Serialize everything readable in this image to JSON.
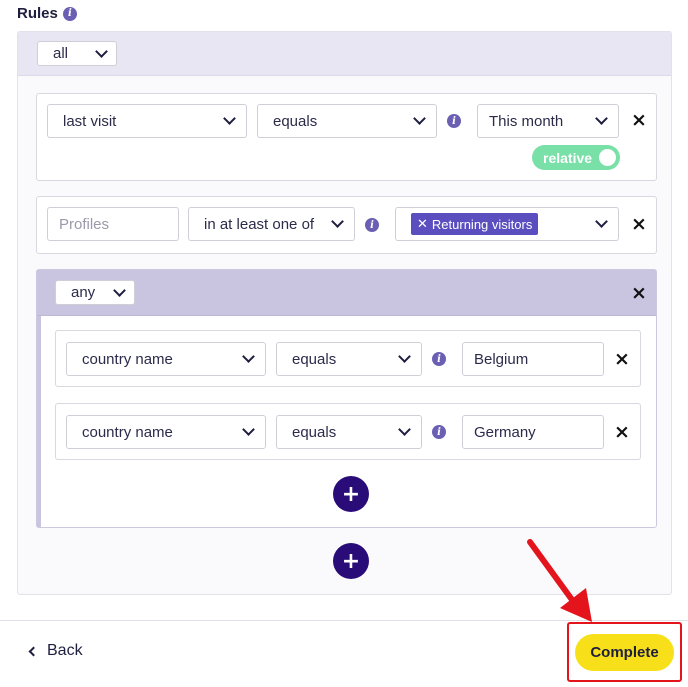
{
  "rules": {
    "title": "Rules",
    "info_icon": "info-icon"
  },
  "outer_group": {
    "match_select": "all",
    "rule1": {
      "field": "last visit",
      "operator": "equals",
      "value": "This month",
      "toggle_label": "relative"
    },
    "rule2": {
      "field_placeholder": "Profiles",
      "operator": "in at least one of",
      "tag": "Returning visitors"
    }
  },
  "inner_group": {
    "match_select": "any",
    "rule1": {
      "field": "country name",
      "operator": "equals",
      "value": "Belgium"
    },
    "rule2": {
      "field": "country name",
      "operator": "equals",
      "value": "Germany"
    }
  },
  "icons": {
    "remove": "×",
    "add": "+",
    "info": "i",
    "tag_remove": "✕"
  },
  "footer": {
    "back_label": "Back",
    "complete_label": "Complete"
  },
  "colors": {
    "accent": "#2a0c78",
    "toggle": "#79e0a8",
    "complete": "#f7e01a",
    "highlight": "#e3141c",
    "tag": "#5b4fc0"
  }
}
